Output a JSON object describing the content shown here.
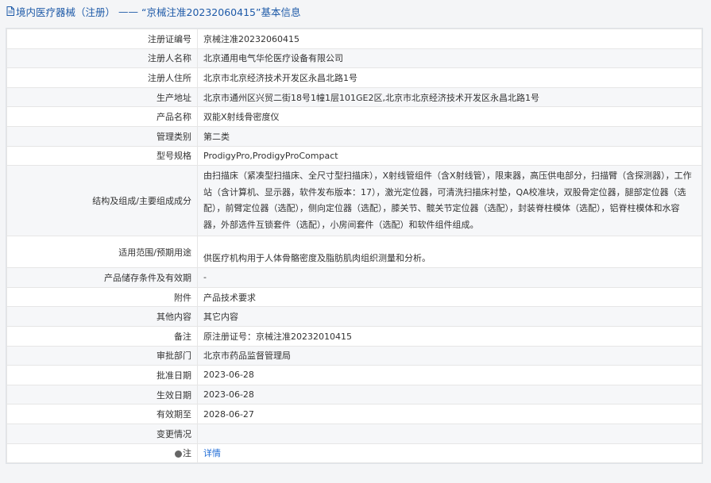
{
  "header": {
    "category": "境内医疗器械（注册）",
    "separator": "——",
    "title": "“京械注准20232060415”基本信息"
  },
  "rows": [
    {
      "label": "注册证编号",
      "value": "京械注准20232060415"
    },
    {
      "label": "注册人名称",
      "value": "北京通用电气华伦医疗设备有限公司"
    },
    {
      "label": "注册人住所",
      "value": "北京市北京经济技术开发区永昌北路1号"
    },
    {
      "label": "生产地址",
      "value": "北京市通州区兴贸二街18号1幢1层101GE2区,北京市北京经济技术开发区永昌北路1号"
    },
    {
      "label": "产品名称",
      "value": "双能X射线骨密度仪"
    },
    {
      "label": "管理类别",
      "value": "第二类"
    },
    {
      "label": "型号规格",
      "value": "ProdigyPro,ProdigyProCompact"
    },
    {
      "label": "结构及组成/主要组成成分",
      "value": "由扫描床（紧凑型扫描床、全尺寸型扫描床），X射线管组件（含X射线管），限束器，高压供电部分，扫描臂（含探测器），工作站（含计算机、显示器，软件发布版本：17），激光定位器，可清洗扫描床衬垫，QA校准块，双股骨定位器，腿部定位器（选配），前臂定位器（选配），侧向定位器（选配），膝关节、髋关节定位器（选配），封装脊柱模体（选配），铝脊柱模体和水容器，外部选件互锁套件（选配），小房间套件（选配）和软件组件组成。"
    },
    {
      "label": "适用范围/预期用途",
      "value": "供医疗机构用于人体骨骼密度及脂肪肌肉组织测量和分析。"
    },
    {
      "label": "产品储存条件及有效期",
      "value": "-"
    },
    {
      "label": "附件",
      "value": "产品技术要求"
    },
    {
      "label": "其他内容",
      "value": "其它内容"
    },
    {
      "label": "备注",
      "value": "原注册证号：京械注准20232010415"
    },
    {
      "label": "审批部门",
      "value": "北京市药品监督管理局"
    },
    {
      "label": "批准日期",
      "value": "2023-06-28"
    },
    {
      "label": "生效日期",
      "value": "2023-06-28"
    },
    {
      "label": "有效期至",
      "value": "2028-06-27"
    },
    {
      "label": "变更情况",
      "value": ""
    }
  ],
  "note": {
    "label": "注",
    "link": "详情",
    "icon": "note-dot-icon"
  }
}
